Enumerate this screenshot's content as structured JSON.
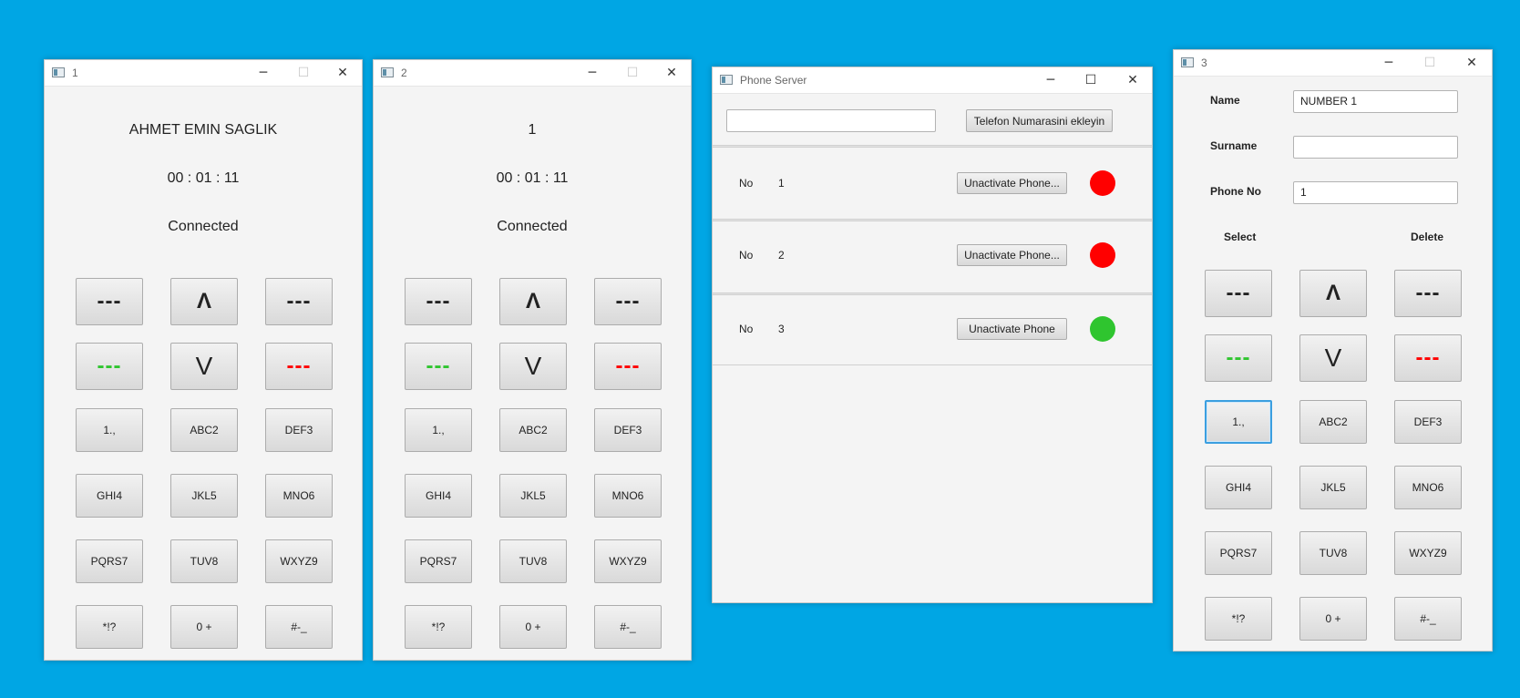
{
  "colors": {
    "desktop": "#00a6e4",
    "green": "#2fc52f",
    "red": "#ff0000"
  },
  "icons": {
    "min": "minimize-icon",
    "max": "maximize-icon",
    "close": "close-icon"
  },
  "keypad": {
    "rows": [
      [
        {
          "label": "---",
          "style": "dash-dark"
        },
        {
          "label": "Λ",
          "style": "big"
        },
        {
          "label": "---",
          "style": "dash-dark"
        }
      ],
      [
        {
          "label": "---",
          "style": "dash-green"
        },
        {
          "label": "V",
          "style": "chev"
        },
        {
          "label": "---",
          "style": "dash-red"
        }
      ],
      [
        {
          "label": "1.,"
        },
        {
          "label": "ABC2"
        },
        {
          "label": "DEF3"
        }
      ],
      [
        {
          "label": "GHI4"
        },
        {
          "label": "JKL5"
        },
        {
          "label": "MNO6"
        }
      ],
      [
        {
          "label": "PQRS7"
        },
        {
          "label": "TUV8"
        },
        {
          "label": "WXYZ9"
        }
      ],
      [
        {
          "label": "*!?"
        },
        {
          "label": "0 +"
        },
        {
          "label": "#-_"
        }
      ]
    ]
  },
  "phone1": {
    "title": "1",
    "caller": "AHMET EMIN SAGLIK",
    "timer": "00 : 01 : 11",
    "status": "Connected"
  },
  "phone2": {
    "title": "2",
    "caller": "1",
    "timer": "00 : 01 : 11",
    "status": "Connected"
  },
  "server": {
    "title": "Phone Server",
    "input_value": "",
    "add_button": "Telefon Numarasini ekleyin",
    "rows": [
      {
        "label": "No",
        "number": "1",
        "button": "Unactivate Phone...",
        "status_color": "#ff0000"
      },
      {
        "label": "No",
        "number": "2",
        "button": "Unactivate Phone...",
        "status_color": "#ff0000"
      },
      {
        "label": "No",
        "number": "3",
        "button": "Unactivate Phone",
        "status_color": "#2fc52f"
      }
    ]
  },
  "phone3": {
    "title": "3",
    "name_label": "Name",
    "name_value": "NUMBER 1",
    "surname_label": "Surname",
    "surname_value": "",
    "phone_label": "Phone No",
    "phone_value": "1",
    "select_label": "Select",
    "delete_label": "Delete"
  }
}
